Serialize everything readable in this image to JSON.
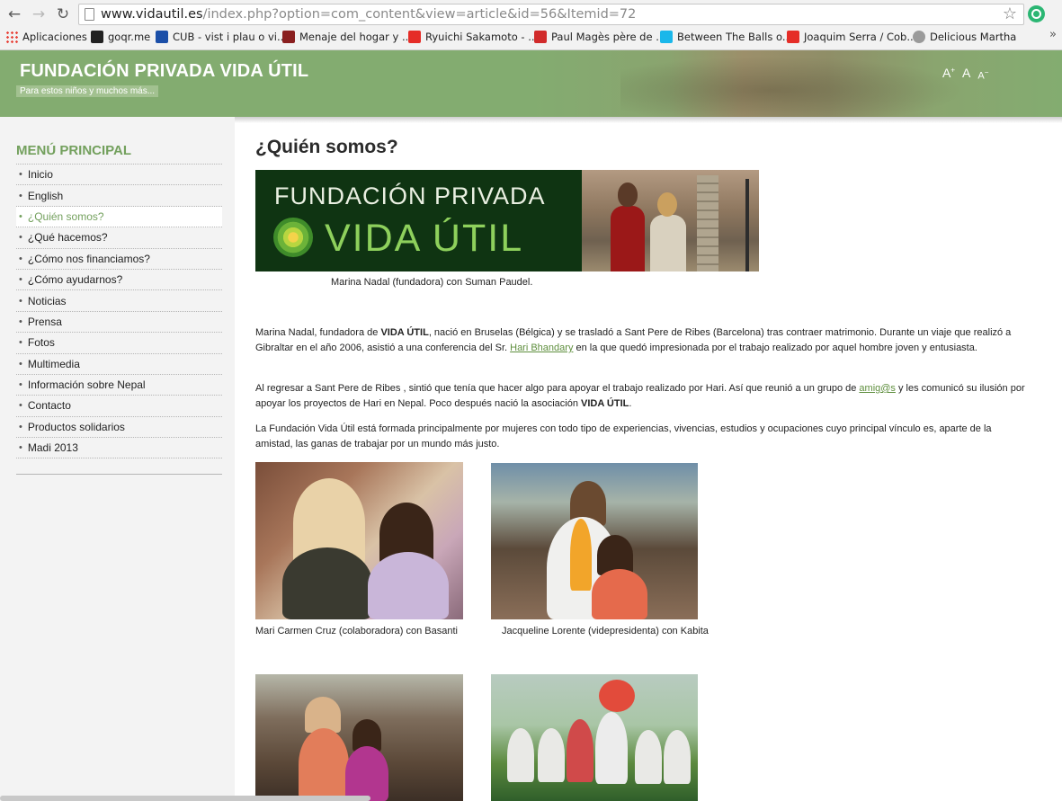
{
  "browser": {
    "url_host": "www.vidautil.es",
    "url_path": "/index.php?option=com_content&view=article&id=56&Itemid=72",
    "bookmarks": [
      {
        "label": "Aplicaciones",
        "color": "#e8453c"
      },
      {
        "label": "goqr.me",
        "color": "#222222"
      },
      {
        "label": "CUB - vist i plau o vi...",
        "color": "#1b4fa8"
      },
      {
        "label": "Menaje del hogar y ...",
        "color": "#8a1f1f"
      },
      {
        "label": "Ryuichi Sakamoto - ...",
        "color": "#e52d27"
      },
      {
        "label": "Paul Magès père de ...",
        "color": "#d12b2b"
      },
      {
        "label": "Between The Balls o...",
        "color": "#1ab7ea"
      },
      {
        "label": "Joaquim Serra / Cob...",
        "color": "#e52d27"
      },
      {
        "label": "Delicious Martha",
        "color": "#9a9a9a"
      }
    ],
    "more": "»"
  },
  "header": {
    "title": "FUNDACIÓN PRIVADA VIDA ÚTIL",
    "tagline": "Para estos niños y muchos más...",
    "font_controls": {
      "bigger": "A",
      "bigger_sup": "+",
      "reset": "A",
      "smaller": "A",
      "smaller_sup": "−"
    }
  },
  "sidebar": {
    "title": "MENÚ PRINCIPAL",
    "items": [
      "Inicio",
      "English",
      "¿Quién somos?",
      "¿Qué hacemos?",
      "¿Cómo nos financiamos?",
      "¿Cómo ayudarnos?",
      "Noticias",
      "Prensa",
      "Fotos",
      "Multimedia",
      "Información sobre Nepal",
      "Contacto",
      "Productos solidarios",
      "Madi 2013"
    ],
    "active_index": 2
  },
  "content": {
    "title": "¿Quién somos?",
    "banner": {
      "line1": "FUNDACIÓN PRIVADA",
      "line2": "VIDA ÚTIL"
    },
    "banner_caption": "Marina Nadal (fundadora) con Suman Paudel.",
    "p1": {
      "a": "Marina Nadal, fundadora de ",
      "b": "VIDA ÚTIL",
      "c": ", nació en Bruselas (Bélgica) y se trasladó a Sant Pere de Ribes (Barcelona) tras contraer matrimonio. Durante un viaje que realizó a Gibraltar en el año 2006, asistió a una conferencia del Sr. ",
      "link": "Hari Bhandary",
      "d": " en la que quedó impresionada por el trabajo realizado por aquel hombre joven y entusiasta."
    },
    "p2": {
      "a": "Al regresar a Sant Pere de Ribes , sintió que tenía que hacer algo para apoyar el trabajo realizado por Hari. Así que reunió a un grupo de ",
      "link": "amig@s",
      "b": " y les comunicó su ilusión por apoyar los proyectos de Hari en Nepal. Poco después nació la asociación ",
      "c": "VIDA ÚTIL",
      "d": "."
    },
    "p3": "La Fundación Vida Útil está formada principalmente por mujeres con todo tipo de experiencias, vivencias, estudios y ocupaciones cuyo principal vínculo es, aparte de la amistad, las ganas de trabajar por un mundo más justo.",
    "photo_captions": [
      "Mari Carmen Cruz (colaboradora) con Basanti",
      "Jacqueline Lorente (videpresidenta) con Kabita"
    ]
  },
  "colors": {
    "accent_green": "#73a05d",
    "header_green": "#83ac70",
    "link_green": "#5f8f3e"
  }
}
